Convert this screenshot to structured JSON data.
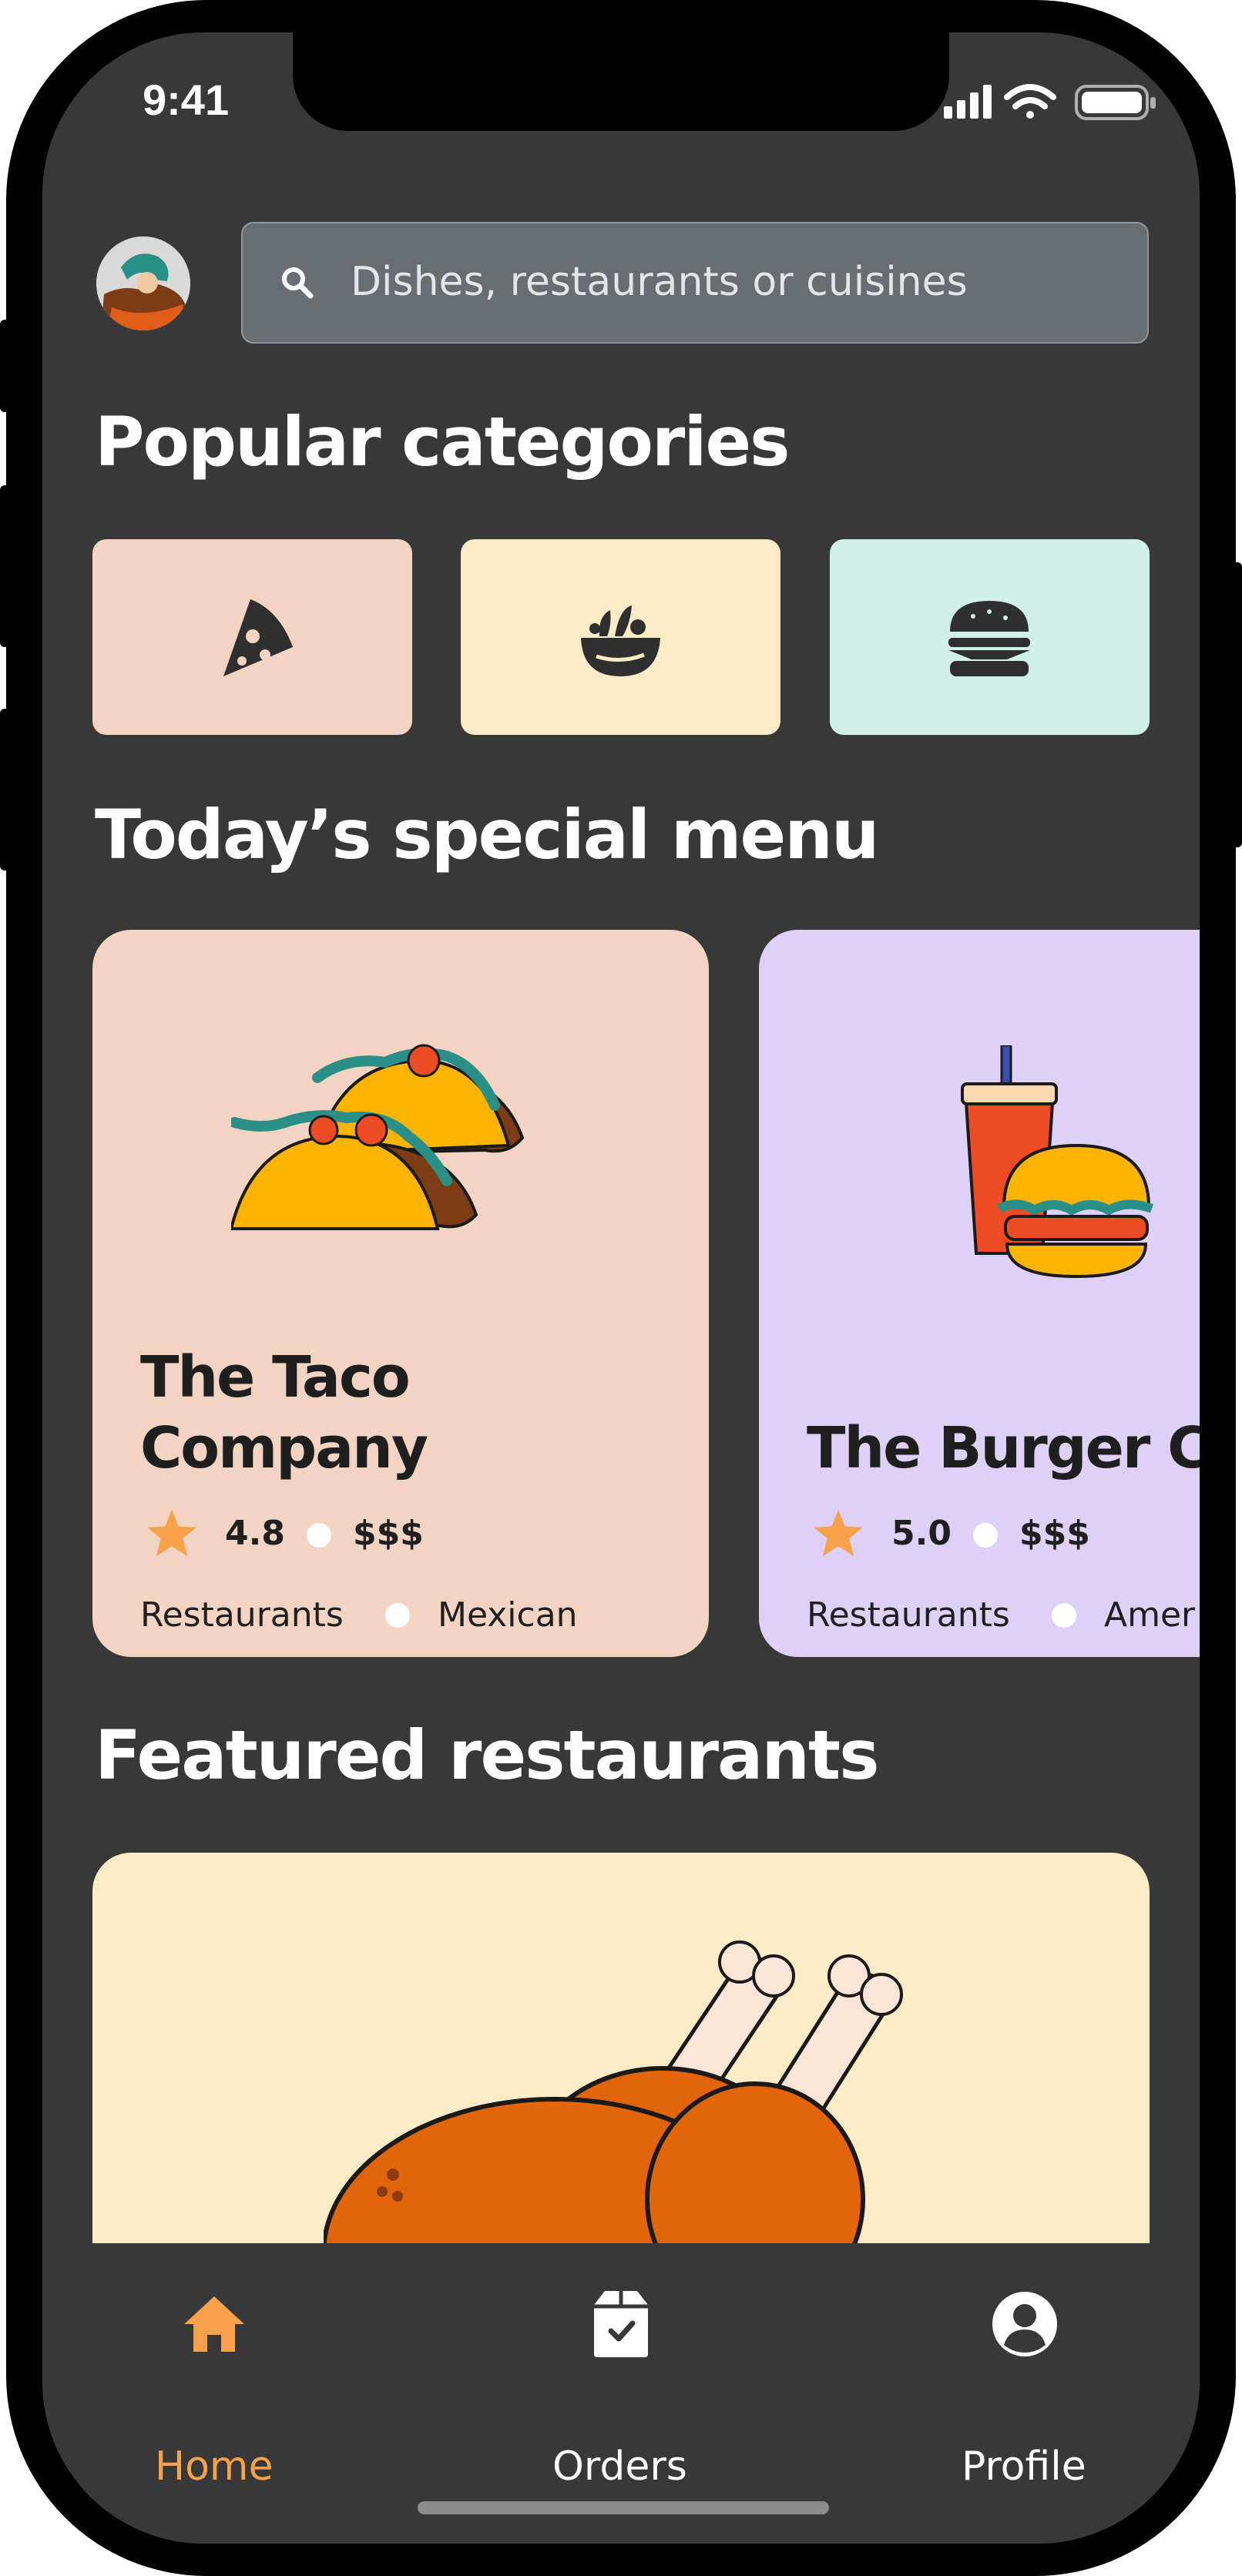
{
  "status_bar": {
    "time": "9:41"
  },
  "header": {
    "search": {
      "placeholder": "Dishes, restaurants or cuisines"
    }
  },
  "popular_categories": {
    "title": "Popular categories",
    "items": [
      {
        "icon": "pizza-icon",
        "color": "#f3d4c3"
      },
      {
        "icon": "salad-bowl-icon",
        "color": "#fdebc8"
      },
      {
        "icon": "burger-icon",
        "color": "#d1f0ea"
      }
    ]
  },
  "special_menu": {
    "title": "Today’s special menu",
    "cards": [
      {
        "name_line1": "The Taco",
        "name_line2": "Company",
        "rating": "4.8",
        "price": "$$$",
        "type": "Restaurants",
        "cuisine": "Mexican",
        "color": "#f3d4c3"
      },
      {
        "name": "The Burger Cl",
        "rating": "5.0",
        "price": "$$$",
        "type": "Restaurants",
        "cuisine": "Amer",
        "color": "#ded0f7"
      }
    ]
  },
  "featured": {
    "title": "Featured restaurants",
    "card_color": "#fdebc8"
  },
  "tab_bar": {
    "tabs": [
      {
        "label": "Home",
        "icon": "home-icon",
        "active": true
      },
      {
        "label": "Orders",
        "icon": "orders-icon",
        "active": false
      },
      {
        "label": "Profile",
        "icon": "profile-icon",
        "active": false
      }
    ],
    "active_color": "#f7a24a",
    "inactive_color": "#ffffff"
  }
}
